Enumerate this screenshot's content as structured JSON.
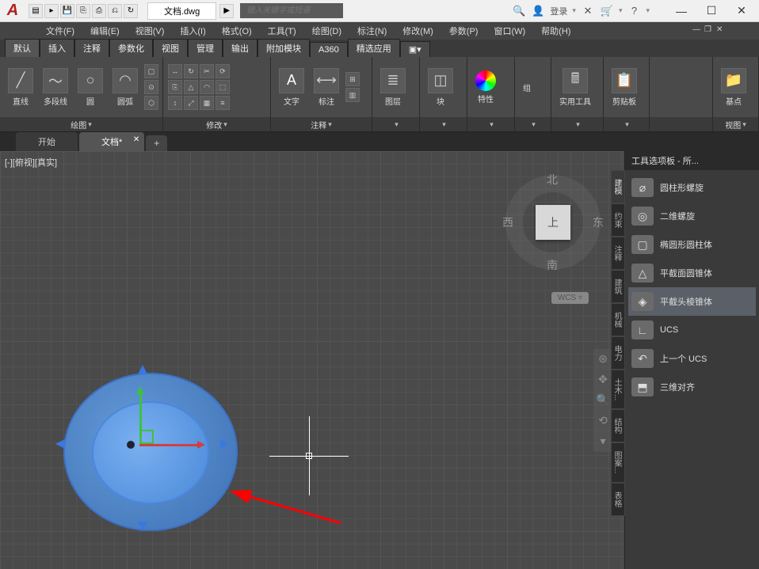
{
  "app": {
    "logo": "A",
    "doc_title": "文档.dwg"
  },
  "search": {
    "placeholder": "键入关键字或短语"
  },
  "titlebar": {
    "login": "登录"
  },
  "menubar": {
    "items": [
      "文件(F)",
      "编辑(E)",
      "视图(V)",
      "插入(I)",
      "格式(O)",
      "工具(T)",
      "绘图(D)",
      "标注(N)",
      "修改(M)",
      "参数(P)",
      "窗口(W)",
      "帮助(H)"
    ]
  },
  "ribbon_tabs": [
    "默认",
    "插入",
    "注释",
    "参数化",
    "视图",
    "管理",
    "输出",
    "附加模块",
    "A360",
    "精选应用"
  ],
  "ribbon": {
    "panel_draw": {
      "title": "绘图",
      "btns": [
        "直线",
        "多段线",
        "圆",
        "圆弧"
      ]
    },
    "panel_mod": {
      "title": "修改"
    },
    "panel_ann": {
      "title": "注释",
      "btns": [
        "文字",
        "标注"
      ]
    },
    "panel_layer": {
      "title": "图层"
    },
    "panel_block": {
      "title": "块"
    },
    "panel_props": {
      "title": "特性"
    },
    "panel_group": {
      "title": "组"
    },
    "panel_util": {
      "title": "实用工具"
    },
    "panel_clip": {
      "title": "剪贴板"
    },
    "panel_base": {
      "title": "基点"
    },
    "panel_view": {
      "title": "视图"
    }
  },
  "doctabs": {
    "start": "开始",
    "current": "文档*"
  },
  "viewport": {
    "label": "[-][俯视][真实]"
  },
  "viewcube": {
    "n": "北",
    "s": "南",
    "e": "东",
    "w": "西",
    "face": "上",
    "wcs": "WCS"
  },
  "palette": {
    "title": "工具选项板 - 所...",
    "tabs": [
      "建模",
      "约束",
      "注释",
      "建筑",
      "机械",
      "电力",
      "土木...",
      "结构",
      "图案...",
      "表格"
    ],
    "items": [
      {
        "label": "圆柱形螺旋",
        "icon": "⌀"
      },
      {
        "label": "二维螺旋",
        "icon": "◎"
      },
      {
        "label": "椭圆形圆柱体",
        "icon": "▢"
      },
      {
        "label": "平截面圆锥体",
        "icon": "△"
      },
      {
        "label": "平截头棱锥体",
        "icon": "◈",
        "selected": true
      },
      {
        "label": "UCS",
        "icon": "∟"
      },
      {
        "label": "上一个 UCS",
        "icon": "↶"
      },
      {
        "label": "三维对齐",
        "icon": "⬒"
      }
    ]
  }
}
